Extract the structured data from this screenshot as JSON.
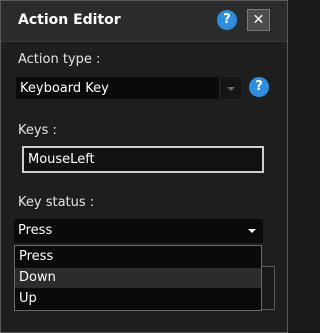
{
  "dialog": {
    "title": "Action Editor",
    "help_glyph": "?",
    "close_glyph": "✕"
  },
  "action_type": {
    "label": "Action type :",
    "value": "Keyboard Key",
    "help_glyph": "?"
  },
  "keys": {
    "label": "Keys :",
    "value": "MouseLeft"
  },
  "key_status": {
    "label": "Key status :",
    "value": "Press",
    "options": [
      "Press",
      "Down",
      "Up"
    ]
  },
  "colors": {
    "help_blue": "#2d8ee0",
    "background": "#1e1e1e",
    "field_bg": "#0a0a0a"
  }
}
